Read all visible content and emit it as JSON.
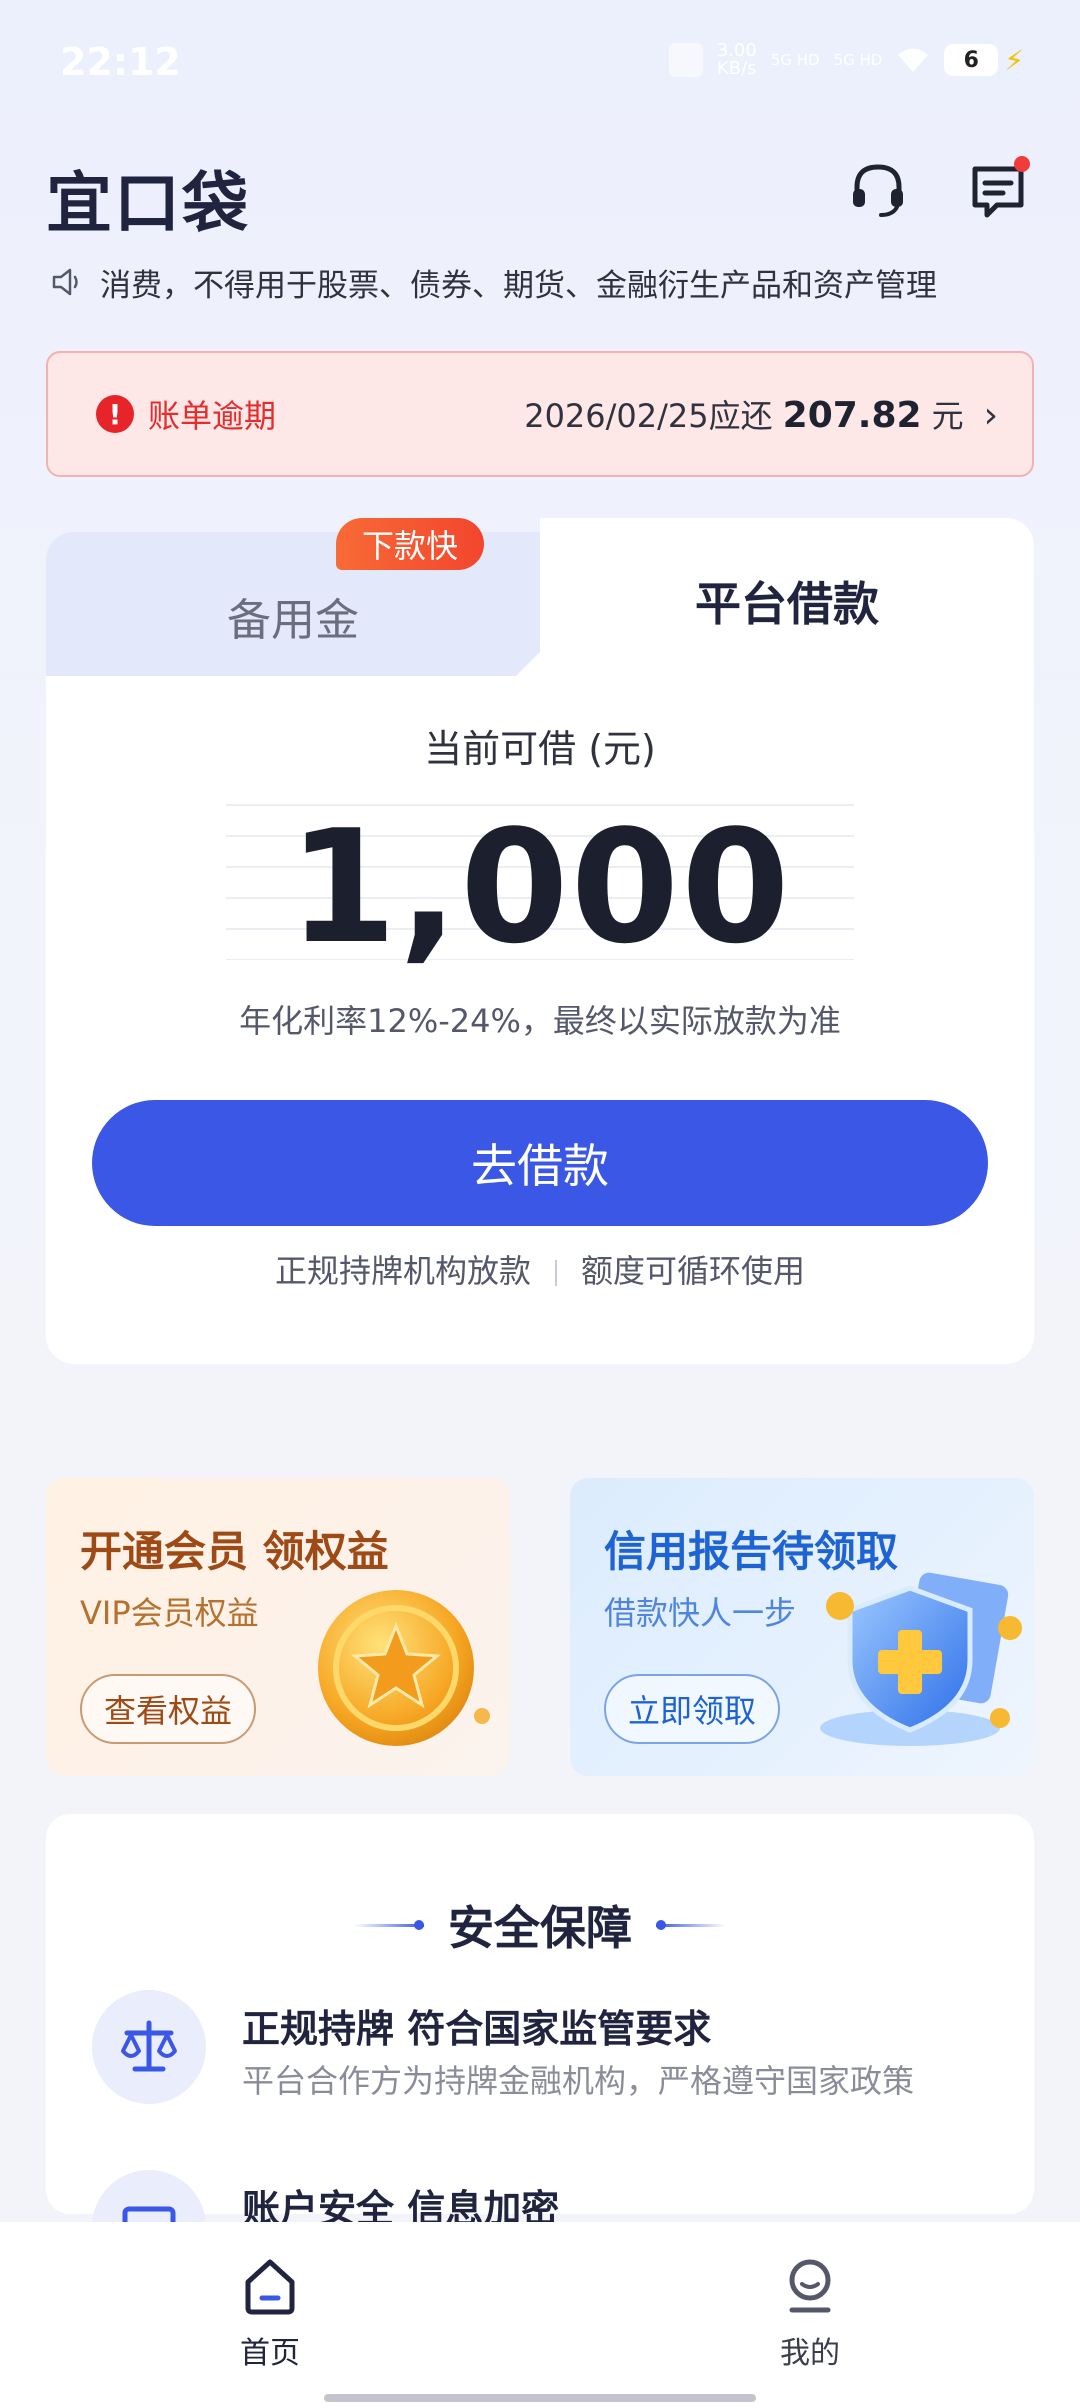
{
  "status_bar": {
    "time": "22:12",
    "net_speed_value": "3.00",
    "net_speed_unit": "KB/s",
    "signal1": "5G HD",
    "signal2": "5G HD",
    "battery": "6"
  },
  "header": {
    "logo": "宜口袋",
    "support_icon": "headset-icon",
    "message_icon": "message-icon"
  },
  "notice": {
    "icon": "speaker-icon",
    "text": "消费，不得用于股票、债券、期货、金融衍生产品和资产管理"
  },
  "overdue": {
    "label": "账单逾期",
    "due_text": "2026/02/25应还",
    "amount": "207.82",
    "unit": "元"
  },
  "loan_card": {
    "tabs": [
      {
        "label": "备用金",
        "badge": "下款快",
        "active": false
      },
      {
        "label": "平台借款",
        "active": true
      }
    ],
    "available_label": "当前可借 (元)",
    "amount": "1,000",
    "rate_text": "年化利率12%-24%，最终以实际放款为准",
    "borrow_button": "去借款",
    "features": [
      "正规持牌机构放款",
      "额度可循环使用"
    ]
  },
  "promos": [
    {
      "title": "开通会员 领权益",
      "subtitle": "VIP会员权益",
      "button": "查看权益"
    },
    {
      "title": "信用报告待领取",
      "subtitle": "借款快人一步",
      "button": "立即领取"
    }
  ],
  "security": {
    "title": "安全保障",
    "items": [
      {
        "title": "正规持牌 符合国家监管要求",
        "desc": "平台合作方为持牌金融机构，严格遵守国家政策",
        "icon": "scale-icon"
      },
      {
        "title": "账户安全 信息加密",
        "desc": "",
        "icon": "card-icon"
      }
    ]
  },
  "bottom_nav": [
    {
      "label": "首页",
      "icon": "home-icon",
      "active": true
    },
    {
      "label": "我的",
      "icon": "profile-icon",
      "active": false
    }
  ],
  "colors": {
    "primary": "#3b57e6",
    "danger": "#e62c2c",
    "badge": "#f2462e"
  }
}
